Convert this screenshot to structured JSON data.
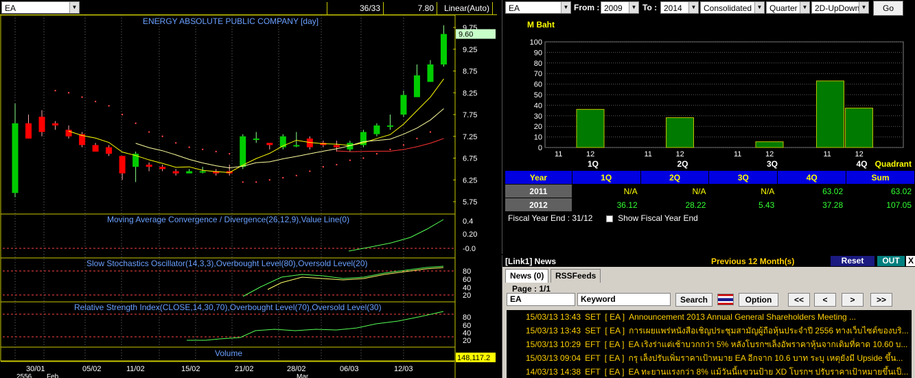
{
  "toolbar": {
    "symbol": "EA",
    "count": "36/33",
    "price": "7.80",
    "scale": "Linear(Auto)"
  },
  "chart": {
    "title": "ENERGY ABSOLUTE PUBLIC COMPANY [day]",
    "price_axis": [
      "9.75",
      "9.25",
      "8.75",
      "8.25",
      "7.75",
      "7.25",
      "6.75",
      "6.25",
      "5.75"
    ],
    "last_price": "9.60",
    "macd_title": "Moving Average Convergence / Divergence(26,12,9),Value Line(0)",
    "macd_axis": [
      "0.4",
      "0.20",
      "-0.0"
    ],
    "stoch_title": "Slow Stochastics Oscillator(14,3,3),Overbought Level(80),Oversold Level(20)",
    "stoch_axis": [
      "80",
      "60",
      "40",
      "20"
    ],
    "rsi_title": "Relative Strength Index(CLOSE,14,30,70),Overbought Level(70),Oversold Level(30)",
    "rsi_axis": [
      "80",
      "60",
      "40",
      "20"
    ],
    "volume_title": "Volume",
    "volume_value": "148,117.2",
    "date_labels": [
      "30/01",
      "05/02",
      "11/02",
      "15/02",
      "21/02",
      "28/02",
      "06/03",
      "12/03"
    ],
    "year_label": "2556",
    "month_labels": [
      "Feb",
      "Mar"
    ],
    "colors": {
      "up": "#00cc00",
      "down": "#ff0000",
      "ma_fast": "#ffff00",
      "ma_mid": "#ffffa0",
      "ma_slow": "#ff3333",
      "sar": "#ff4444",
      "grid": "#707070",
      "axis": "#c8c800"
    }
  },
  "chart_data": [
    {
      "type": "candlestick",
      "title": "ENERGY ABSOLUTE PUBLIC COMPANY [day]",
      "ylim": [
        5.75,
        9.75
      ],
      "x": [
        "30/01",
        "31/01",
        "01/02",
        "04/02",
        "05/02",
        "06/02",
        "07/02",
        "08/02",
        "11/02",
        "12/02",
        "13/02",
        "14/02",
        "15/02",
        "18/02",
        "19/02",
        "20/02",
        "21/02",
        "22/02",
        "25/02",
        "26/02",
        "27/02",
        "28/02",
        "01/03",
        "04/03",
        "05/03",
        "06/03",
        "07/03",
        "08/03",
        "11/03",
        "12/03",
        "13/03",
        "14/03",
        "15/03"
      ],
      "open": [
        5.95,
        7.55,
        7.7,
        7.55,
        7.4,
        7.3,
        7.05,
        7.0,
        6.8,
        6.55,
        6.6,
        6.55,
        6.45,
        6.4,
        6.45,
        6.45,
        6.45,
        6.55,
        7.2,
        7.1,
        7.0,
        7.05,
        7.2,
        7.1,
        7.05,
        6.95,
        7.05,
        7.3,
        7.5,
        7.75,
        8.15,
        8.5,
        8.9
      ],
      "close": [
        7.55,
        7.2,
        7.35,
        7.5,
        7.25,
        7.05,
        6.9,
        6.85,
        6.4,
        6.85,
        6.55,
        6.5,
        6.4,
        6.45,
        6.45,
        6.4,
        6.4,
        7.25,
        7.2,
        7.05,
        7.25,
        7.05,
        7.0,
        7.05,
        7.0,
        7.1,
        7.35,
        7.5,
        7.5,
        8.2,
        8.65,
        8.9,
        9.6
      ],
      "high": [
        8.0,
        7.75,
        7.85,
        7.6,
        7.5,
        7.35,
        7.1,
        7.05,
        6.8,
        6.9,
        6.65,
        6.6,
        6.5,
        6.5,
        6.55,
        6.5,
        6.6,
        7.3,
        7.35,
        7.1,
        7.3,
        7.35,
        7.25,
        7.15,
        7.15,
        7.15,
        7.4,
        7.55,
        7.75,
        8.3,
        8.9,
        9.0,
        9.8
      ],
      "low": [
        5.85,
        7.2,
        7.25,
        7.4,
        7.2,
        7.0,
        6.9,
        6.8,
        6.25,
        6.2,
        6.45,
        6.45,
        6.35,
        6.4,
        6.4,
        6.35,
        6.35,
        6.5,
        7.1,
        6.95,
        6.95,
        7.0,
        6.95,
        7.0,
        6.9,
        6.9,
        7.0,
        7.25,
        7.4,
        7.7,
        8.15,
        8.5,
        8.85
      ]
    },
    {
      "type": "bar",
      "title": "M Baht",
      "xlabel": "Quadrant",
      "categories": [
        "1Q",
        "2Q",
        "3Q",
        "4Q"
      ],
      "ylim": [
        0,
        100
      ],
      "series": [
        {
          "name": "2011",
          "values": [
            null,
            null,
            null,
            63.02
          ]
        },
        {
          "name": "2012",
          "values": [
            36.12,
            28.22,
            5.43,
            37.28
          ]
        }
      ]
    }
  ],
  "fundamental": {
    "from_label": "From :",
    "from_year": "2009",
    "to_label": "To :",
    "to_year": "2014",
    "mode": "Consolidated",
    "period": "Quarter",
    "view": "2D-UpDown",
    "go_label": "Go",
    "unit": "M Baht",
    "y_axis": [
      "100",
      "90",
      "80",
      "70",
      "60",
      "50",
      "40",
      "30",
      "20",
      "10",
      "0"
    ],
    "bar_sub": [
      "11",
      "12"
    ],
    "quarter_labels": [
      "1Q",
      "2Q",
      "3Q",
      "4Q"
    ],
    "quadrant_label": "Quadrant",
    "bar_colors": {
      "fill": "#007a00",
      "border": "#c0c000"
    },
    "table": {
      "headers": [
        "Year",
        "1Q",
        "2Q",
        "3Q",
        "4Q",
        "Sum"
      ],
      "rows": [
        {
          "year": "2011",
          "q1": "N/A",
          "q2": "N/A",
          "q3": "N/A",
          "q4": "63.02",
          "sum": "63.02"
        },
        {
          "year": "2012",
          "q1": "36.12",
          "q2": "28.22",
          "q3": "5.43",
          "q4": "37.28",
          "sum": "107.05"
        }
      ]
    },
    "fiscal_label": "Fiscal  Year  End  :  31/12",
    "show_fiscal_label": "Show Fiscal Year End"
  },
  "news": {
    "title": "[Link1] News",
    "period": "Previous 12 Month(s)",
    "reset_label": "Reset",
    "out_label": "OUT",
    "close_label": "X",
    "tab_news": "News (0)",
    "tab_rss": "RSSFeeds",
    "page": "Page : 1/1",
    "symbol": "EA",
    "keyword_placeholder": "Keyword",
    "search_label": "Search",
    "option_label": "Option",
    "nav": [
      "<<",
      "<",
      ">",
      ">>"
    ],
    "items": [
      {
        "time": "15/03/13 13:43",
        "src": "SET",
        "sym": "[ EA ]",
        "headline": "Announcement 2013 Annual General Shareholders  Meeting ..."
      },
      {
        "time": "15/03/13 13:43",
        "src": "SET",
        "sym": "[ EA ]",
        "headline": "การเผยแพร่หนังสือเชิญประชุมสามัญผู้ถือหุ้นประจำปี 2556 ทางเว็บไซต์ของบริ..."
      },
      {
        "time": "15/03/13 10:29",
        "src": "EFT",
        "sym": "[ EA ]",
        "headline": "EA เริงร่าแต่เช้าบวกกว่า 5% หลังโบรกฯเล็งอัพราคาหุ้นจากเดิมที่คาด 10.60 บ..."
      },
      {
        "time": "15/03/13 09:04",
        "src": "EFT",
        "sym": "[ EA ]",
        "headline": "กรุ เล็งปรับเพิ่มราคาเป้าหมาย EA อีกจาก 10.6 บาท ระบุ เหตุยังมี Upside ขึ้น..."
      },
      {
        "time": "14/03/13 14:38",
        "src": "EFT",
        "sym": "[ EA ]",
        "headline": "EA ทะยานแรงกว่า 8% แม้วันนี้แขวนป้าย XD โบรกฯ ปรับราคาเป้าหมายขึ้นเป็..."
      }
    ]
  }
}
